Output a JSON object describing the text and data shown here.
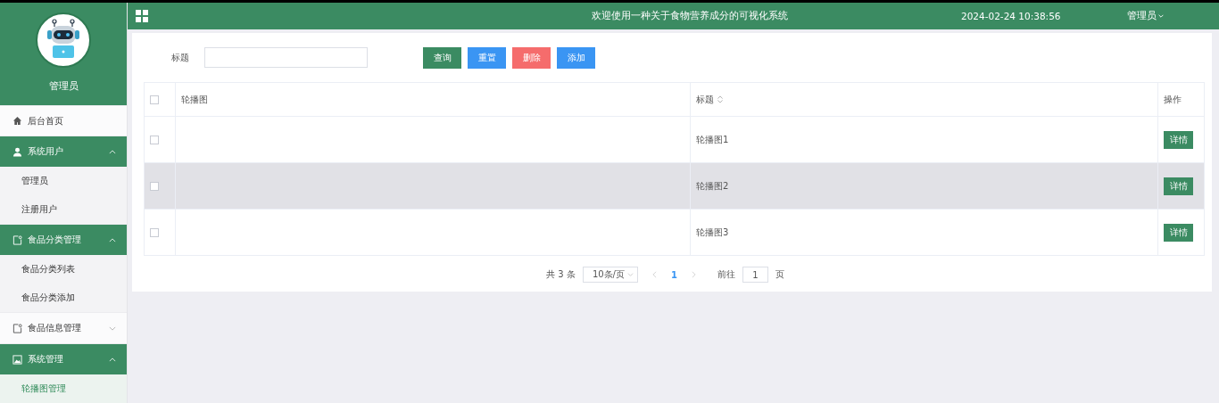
{
  "sidebar": {
    "user_name": "管理员",
    "menu": [
      {
        "label": "后台首页",
        "kind": "home",
        "expanded": false
      },
      {
        "label": "系统用户",
        "kind": "user",
        "expanded": true,
        "children": [
          {
            "label": "管理员",
            "selected": false
          },
          {
            "label": "注册用户",
            "selected": false
          }
        ]
      },
      {
        "label": "食品分类管理",
        "kind": "doc",
        "expanded": true,
        "children": [
          {
            "label": "食品分类列表",
            "selected": false
          },
          {
            "label": "食品分类添加",
            "selected": false
          }
        ]
      },
      {
        "label": "食品信息管理",
        "kind": "doc",
        "expanded": false
      },
      {
        "label": "系统管理",
        "kind": "image",
        "expanded": true,
        "children": [
          {
            "label": "轮播图管理",
            "selected": true
          }
        ]
      }
    ]
  },
  "header": {
    "title": "欢迎使用一种关于食物营养成分的可视化系统",
    "datetime": "2024-02-24 10:38:56",
    "user": "管理员"
  },
  "search": {
    "label": "标题",
    "buttons": [
      {
        "label": "查询",
        "kind": "search"
      },
      {
        "label": "重置",
        "kind": "reset"
      },
      {
        "label": "删除",
        "kind": "delete"
      },
      {
        "label": "添加",
        "kind": "add"
      }
    ]
  },
  "table": {
    "select_all_checked": false,
    "columns": [
      "轮播图",
      "标题",
      "操作"
    ],
    "rows": [
      {
        "checked": false,
        "highlighted": false,
        "title": "轮播图1",
        "action": "详情"
      },
      {
        "checked": false,
        "highlighted": true,
        "title": "轮播图2",
        "action": "详情"
      },
      {
        "checked": false,
        "highlighted": false,
        "title": "轮播图3",
        "action": "详情"
      }
    ]
  },
  "pagination": {
    "total": "共 3 条",
    "page_size": "10条/页",
    "pages": [
      {
        "label": "1",
        "selected": true
      }
    ],
    "goto_label": "前往",
    "goto_value": "1",
    "goto_suffix": "页"
  }
}
